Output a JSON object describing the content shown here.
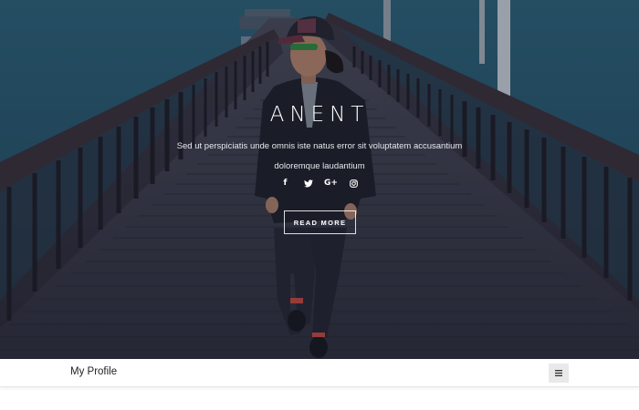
{
  "hero": {
    "title": "ANENT",
    "description_line1": "Sed ut perspiciatis unde omnis iste natus error sit voluptatem accusantium",
    "description_line2": "doloremque laudantium",
    "social": {
      "facebook": "f",
      "google_plus": "G+"
    },
    "social_icons": [
      "facebook-icon",
      "twitter-icon",
      "google-plus-icon",
      "instagram-icon"
    ],
    "button_label": "READ MORE"
  },
  "navbar": {
    "brand": "My Profile",
    "menu_icon": "hamburger-icon"
  },
  "colors": {
    "hero_overlay": "#141c30",
    "sea": "#2a5a72",
    "deck": "#3a3a48",
    "navbar_bg": "#ffffff",
    "toggle_bg": "#e9e9e9",
    "text_light": "#ffffff",
    "text_dark": "#222222"
  }
}
